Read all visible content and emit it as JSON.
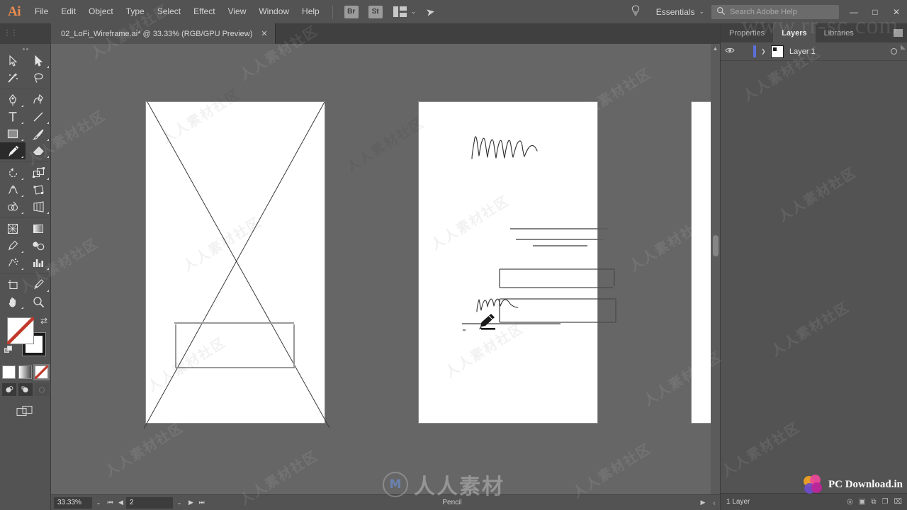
{
  "app": {
    "name": "Adobe Illustrator",
    "logo_text": "Ai"
  },
  "menubar": {
    "items": [
      {
        "label": "File"
      },
      {
        "label": "Edit"
      },
      {
        "label": "Object"
      },
      {
        "label": "Type"
      },
      {
        "label": "Select"
      },
      {
        "label": "Effect"
      },
      {
        "label": "View"
      },
      {
        "label": "Window"
      },
      {
        "label": "Help"
      }
    ],
    "bridge_label": "Br",
    "stock_label": "St",
    "arrange_icon": "arrange-documents-icon",
    "arrange_chevron": "⌄",
    "rocket_icon": "➤",
    "bulb_icon": "☁",
    "workspace": "Essentials",
    "workspace_chevron": "⌄"
  },
  "search": {
    "placeholder": "Search Adobe Help",
    "icon": "search-icon",
    "glyph": "⚲"
  },
  "window_controls": {
    "minimize": "—",
    "maximize": "□",
    "close": "✕"
  },
  "tabbar": {
    "document": {
      "title": "02_LoFi_Wireframe.ai* @ 33.33% (RGB/GPU Preview)",
      "close": "✕"
    }
  },
  "toolbar": {
    "grip": "toolbar-grip",
    "tools": [
      {
        "name": "selection-tool",
        "has_corner": false
      },
      {
        "name": "direct-selection-tool",
        "has_corner": true
      },
      {
        "name": "magic-wand-tool",
        "has_corner": false
      },
      {
        "name": "lasso-tool",
        "has_corner": false
      },
      {
        "name": "pen-tool",
        "has_corner": true
      },
      {
        "name": "curvature-tool",
        "has_corner": false
      },
      {
        "name": "type-tool",
        "has_corner": true
      },
      {
        "name": "line-segment-tool",
        "has_corner": true
      },
      {
        "name": "rectangle-tool",
        "has_corner": true
      },
      {
        "name": "paintbrush-tool",
        "has_corner": true
      },
      {
        "name": "pencil-tool",
        "has_corner": true,
        "active": true
      },
      {
        "name": "eraser-tool",
        "has_corner": true
      },
      {
        "name": "rotate-tool",
        "has_corner": true
      },
      {
        "name": "scale-tool",
        "has_corner": true
      },
      {
        "name": "width-tool",
        "has_corner": true
      },
      {
        "name": "free-transform-tool",
        "has_corner": false
      },
      {
        "name": "shape-builder-tool",
        "has_corner": true
      },
      {
        "name": "perspective-grid-tool",
        "has_corner": true
      },
      {
        "name": "mesh-tool",
        "has_corner": false
      },
      {
        "name": "gradient-tool",
        "has_corner": false
      },
      {
        "name": "eyedropper-tool",
        "has_corner": true
      },
      {
        "name": "blend-tool",
        "has_corner": false
      },
      {
        "name": "symbol-sprayer-tool",
        "has_corner": true
      },
      {
        "name": "column-graph-tool",
        "has_corner": true
      },
      {
        "name": "artboard-tool",
        "has_corner": false
      },
      {
        "name": "slice-tool",
        "has_corner": true
      },
      {
        "name": "hand-tool",
        "has_corner": true
      },
      {
        "name": "zoom-tool",
        "has_corner": false
      }
    ],
    "fill_swatch": {
      "name": "fill-color-swatch",
      "value": "#ffffff",
      "none": true
    },
    "stroke_swatch": {
      "name": "stroke-color-swatch",
      "value": "#1a1a1a"
    },
    "swap_icon": "⇄",
    "color_modes": [
      {
        "name": "color-mode-solid",
        "selected": false
      },
      {
        "name": "color-mode-gradient",
        "selected": false
      },
      {
        "name": "color-mode-none",
        "selected": true
      }
    ],
    "draw_modes": [
      {
        "name": "draw-normal-mode",
        "enabled": true
      },
      {
        "name": "draw-behind-mode",
        "enabled": true
      },
      {
        "name": "draw-inside-mode",
        "enabled": false
      }
    ],
    "screen_mode": {
      "name": "change-screen-mode"
    }
  },
  "canvas": {
    "background": "#666666",
    "artboards": [
      {
        "name": "artboard-1",
        "content": "empty-placeholder-with-x-and-rectangle"
      },
      {
        "name": "artboard-2",
        "content": "sketched-wireframe-heading-lines-boxes"
      },
      {
        "name": "artboard-3",
        "content": "blank"
      }
    ],
    "scrollbar": {
      "name": "vertical-scrollbar",
      "up_arrow": "▲"
    }
  },
  "statusbar": {
    "zoom_level": "33.33%",
    "zoom_chevron": "⌄",
    "first_page": "⏮",
    "prev_page": "◀",
    "page_number": "2",
    "page_chevron": "⌄",
    "next_page": "▶",
    "last_page": "⏭",
    "current_tool": "Pencil",
    "status_next": "▶",
    "status_prev": "‹"
  },
  "right_panel": {
    "tabs": [
      {
        "label": "Properties",
        "active": false
      },
      {
        "label": "Layers",
        "active": true
      },
      {
        "label": "Libraries",
        "active": false
      }
    ],
    "panel_menu_icon": "panel-menu-icon",
    "layers": [
      {
        "name": "Layer 1",
        "visible": true,
        "eye_glyph": "◉",
        "disclosure": "❯",
        "selected": true
      }
    ],
    "footer": {
      "count_label": "1 Layer",
      "icons": [
        {
          "name": "locate-object-icon",
          "glyph": "◎"
        },
        {
          "name": "make-clipping-mask-icon",
          "glyph": "▣"
        },
        {
          "name": "create-sublayer-icon",
          "glyph": "⧉"
        },
        {
          "name": "create-new-layer-icon",
          "glyph": "❐"
        },
        {
          "name": "delete-layer-icon",
          "glyph": "⌧"
        }
      ]
    }
  },
  "watermarks": {
    "tiled_text": "人人素材社区",
    "url_text": "www.rr-sc.com",
    "center_text": "人人素材",
    "center_mark": "M",
    "brand_text": "PC Download.in"
  },
  "chart_data": null
}
